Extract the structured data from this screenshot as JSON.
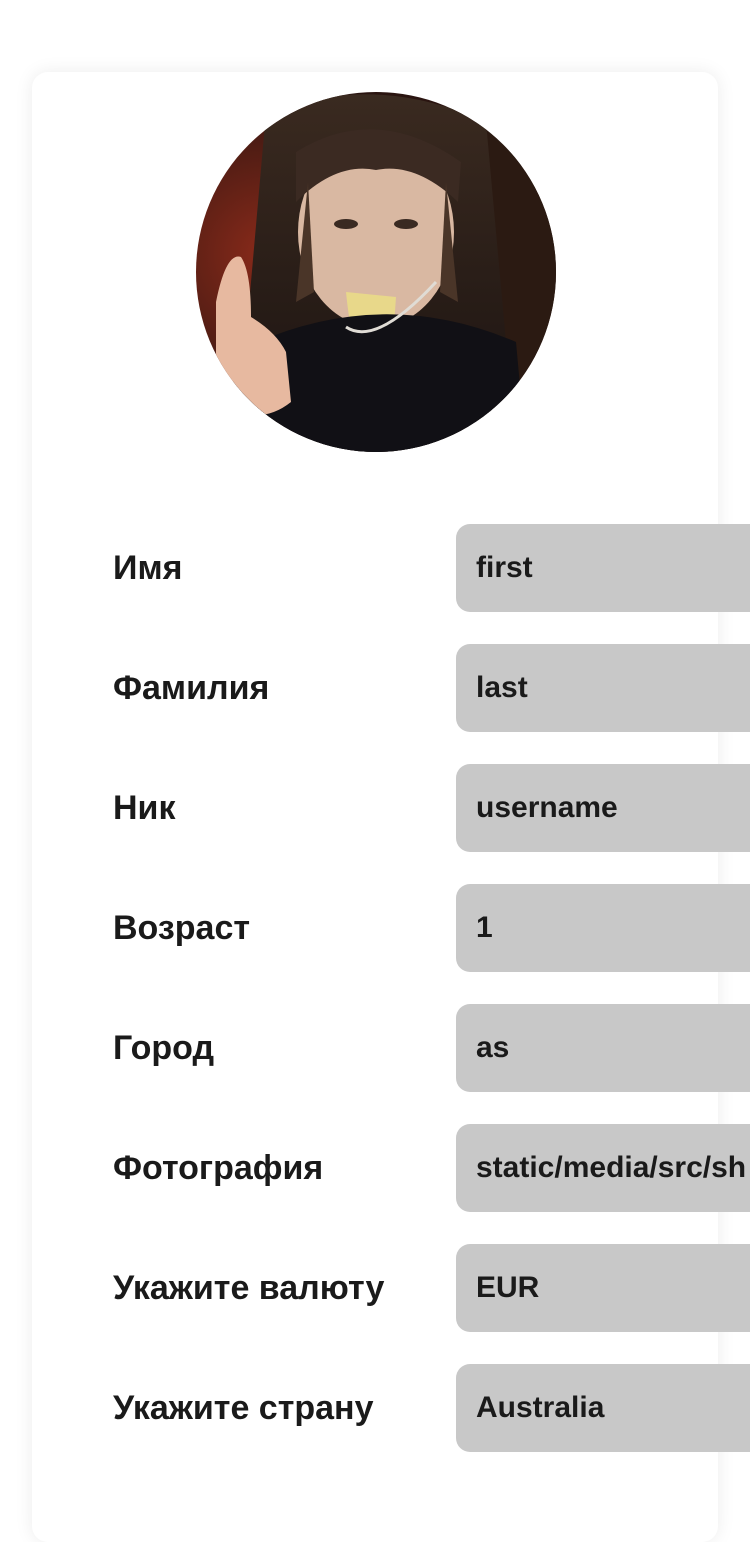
{
  "profile": {
    "avatar": {
      "icon": "profile-photo"
    },
    "fields": [
      {
        "label": "Имя",
        "value": "first"
      },
      {
        "label": "Фамилия",
        "value": "last"
      },
      {
        "label": "Ник",
        "value": "username"
      },
      {
        "label": "Возраст",
        "value": "1"
      },
      {
        "label": "Город",
        "value": "as"
      },
      {
        "label": "Фотография",
        "value": "static/media/src/sh"
      },
      {
        "label": "Укажите валюту",
        "value": "EUR"
      },
      {
        "label": "Укажите страну",
        "value": "Australia"
      }
    ]
  },
  "colors": {
    "input_bg": "#c8c8c8",
    "text": "#1a1a1a",
    "card_bg": "#ffffff"
  }
}
